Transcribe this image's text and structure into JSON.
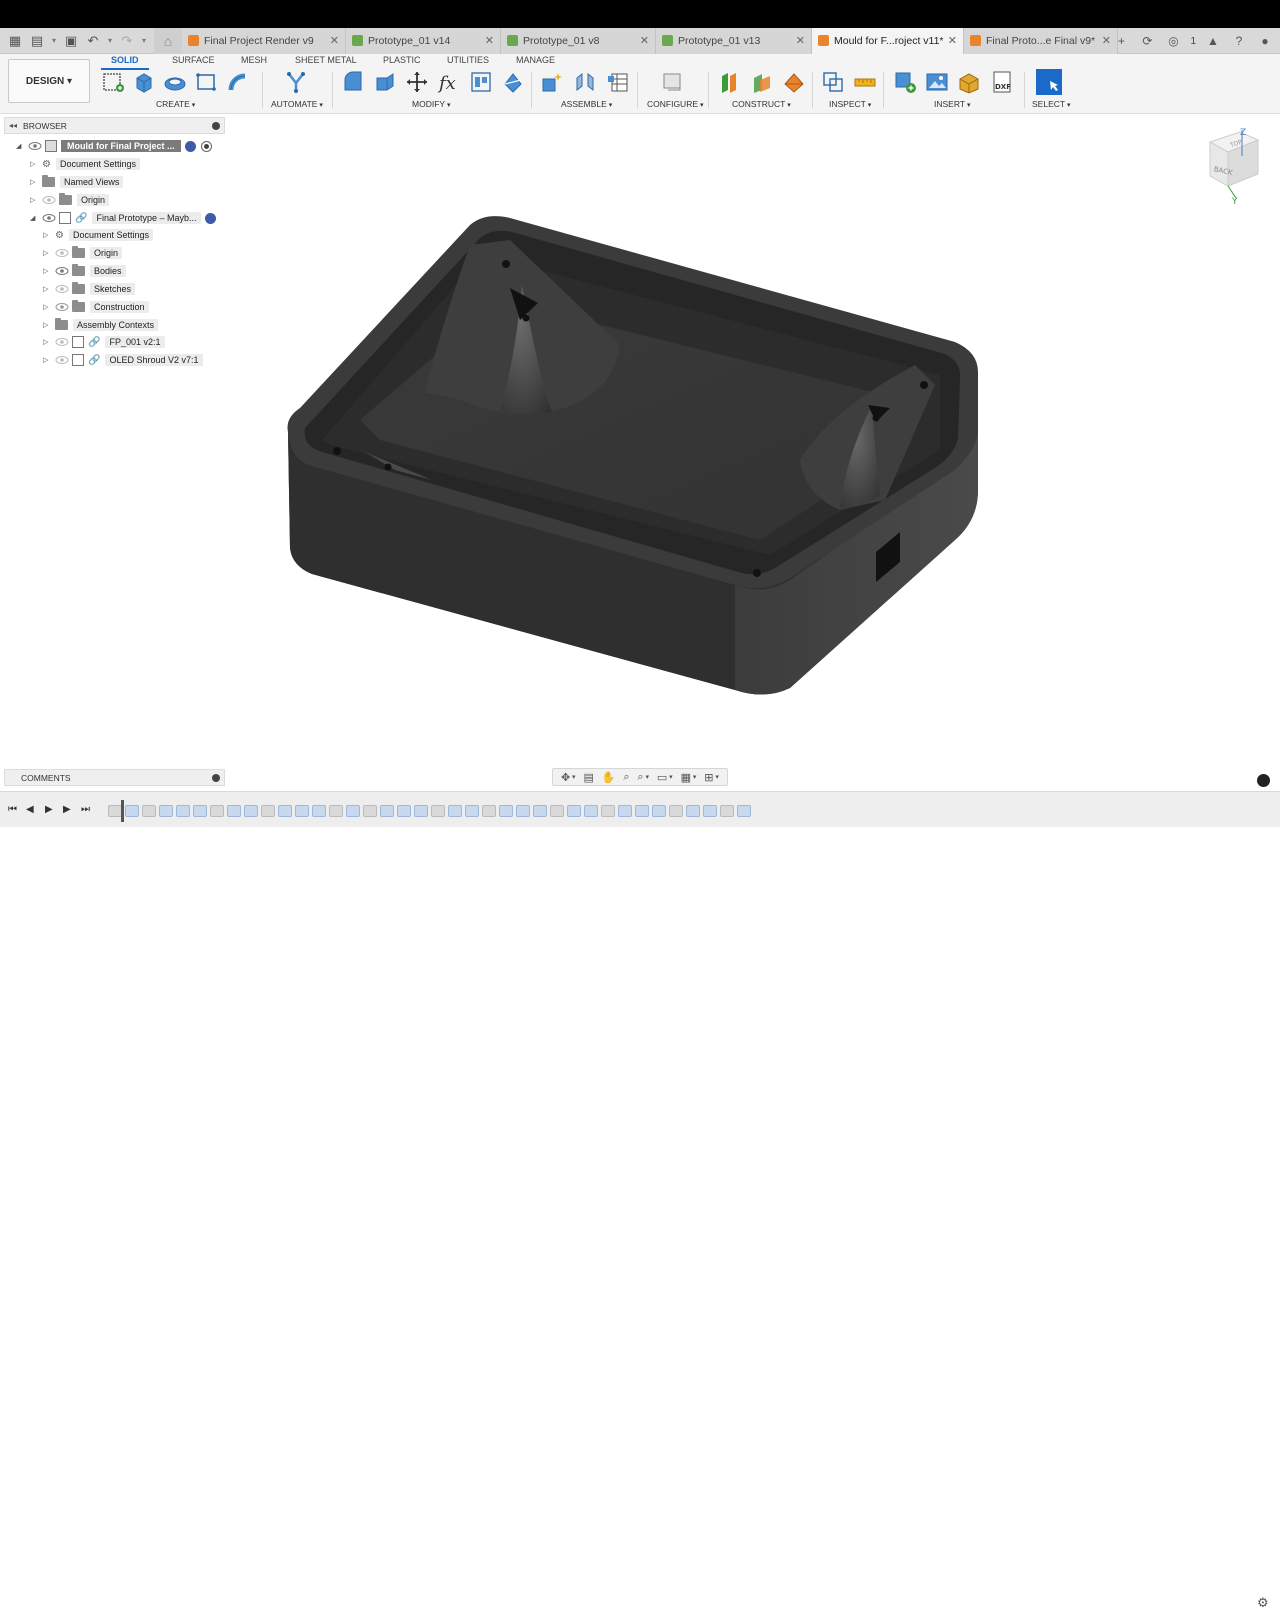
{
  "tabs": [
    {
      "label": "Final Project Render v9",
      "color": "#e8842c",
      "active": false
    },
    {
      "label": "Prototype_01 v14",
      "color": "#6aa84f",
      "active": false
    },
    {
      "label": "Prototype_01 v8",
      "color": "#6aa84f",
      "active": false
    },
    {
      "label": "Prototype_01 v13",
      "color": "#6aa84f",
      "active": false
    },
    {
      "label": "Mould for F...roject v11*",
      "color": "#e8842c",
      "active": true
    },
    {
      "label": "Final Proto...e Final v9*",
      "color": "#e8842c",
      "active": false
    }
  ],
  "tabbar": {
    "close": "✕",
    "job_count": "1"
  },
  "toolbar": {
    "design_label": "DESIGN ▾",
    "workspace_tabs": [
      "SOLID",
      "SURFACE",
      "MESH",
      "SHEET METAL",
      "PLASTIC",
      "UTILITIES",
      "MANAGE"
    ],
    "groups": [
      "CREATE",
      "AUTOMATE",
      "MODIFY",
      "ASSEMBLE",
      "CONFIGURE",
      "CONSTRUCT",
      "INSPECT",
      "INSERT",
      "SELECT"
    ],
    "dxf_label": "DXF",
    "fx_label": "fx"
  },
  "browser": {
    "title": "BROWSER",
    "root": "Mould for Final Project ...",
    "items": [
      {
        "label": "Document Settings"
      },
      {
        "label": "Named Views"
      },
      {
        "label": "Origin"
      },
      {
        "label": "Final Prototype – Mayb..."
      },
      {
        "label": "Document Settings"
      },
      {
        "label": "Origin"
      },
      {
        "label": "Bodies"
      },
      {
        "label": "Sketches"
      },
      {
        "label": "Construction"
      },
      {
        "label": "Assembly Contexts"
      },
      {
        "label": "FP_001 v2:1"
      },
      {
        "label": "OLED Shroud V2 v7:1"
      }
    ]
  },
  "viewcube": {
    "top_face": "TOP",
    "front_face": "BACK",
    "z_axis": "Z",
    "y_axis": "Y"
  },
  "comments": {
    "title": "COMMENTS"
  },
  "colors": {
    "accent": "#1b6ac9",
    "model": "#3a3a3a",
    "model_dark": "#262626"
  }
}
